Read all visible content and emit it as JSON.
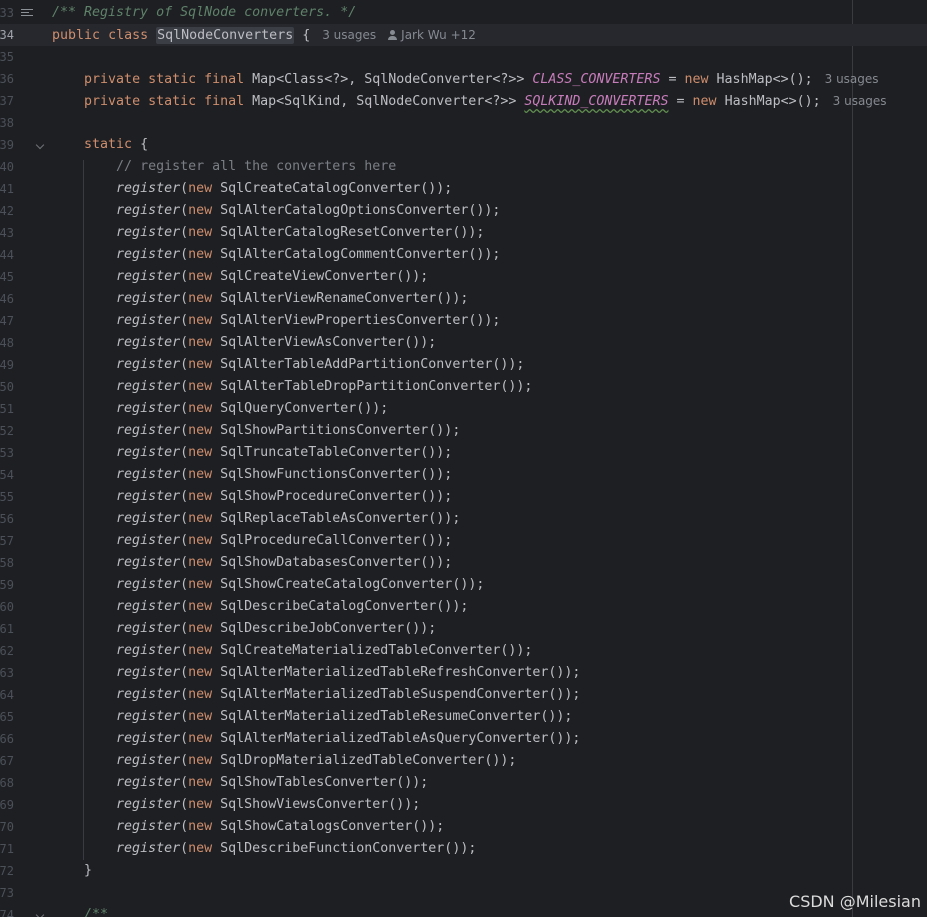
{
  "comment_doc": "/** Registry of SqlNode converters. */",
  "class_decl": {
    "kw_public": "public",
    "kw_class": "class",
    "name": "SqlNodeConverters",
    "brace": "{",
    "usages": "3 usages",
    "authors": "Jark Wu +12"
  },
  "fields": [
    {
      "kw": "private static final",
      "type": "Map<Class<?>, SqlNodeConverter<?>>",
      "name": "CLASS_CONVERTERS",
      "eq": "=",
      "kw_new": "new",
      "init": "HashMap<>();",
      "usages": "3 usages"
    },
    {
      "kw": "private static final",
      "type": "Map<SqlKind, SqlNodeConverter<?>>",
      "name": "SQLKIND_CONVERTERS",
      "eq": "=",
      "kw_new": "new",
      "init": "HashMap<>();",
      "usages": "3 usages"
    }
  ],
  "static_kw": "static",
  "static_brace": "{",
  "inner_comment": "// register all the converters here",
  "register_fn": "register",
  "paren_open": "(",
  "kw_new": "new",
  "converters": [
    "SqlCreateCatalogConverter());",
    "SqlAlterCatalogOptionsConverter());",
    "SqlAlterCatalogResetConverter());",
    "SqlAlterCatalogCommentConverter());",
    "SqlCreateViewConverter());",
    "SqlAlterViewRenameConverter());",
    "SqlAlterViewPropertiesConverter());",
    "SqlAlterViewAsConverter());",
    "SqlAlterTableAddPartitionConverter());",
    "SqlAlterTableDropPartitionConverter());",
    "SqlQueryConverter());",
    "SqlShowPartitionsConverter());",
    "SqlTruncateTableConverter());",
    "SqlShowFunctionsConverter());",
    "SqlShowProcedureConverter());",
    "SqlReplaceTableAsConverter());",
    "SqlProcedureCallConverter());",
    "SqlShowDatabasesConverter());",
    "SqlShowCreateCatalogConverter());",
    "SqlDescribeCatalogConverter());",
    "SqlDescribeJobConverter());",
    "SqlCreateMaterializedTableConverter());",
    "SqlAlterMaterializedTableRefreshConverter());",
    "SqlAlterMaterializedTableSuspendConverter());",
    "SqlAlterMaterializedTableResumeConverter());",
    "SqlAlterMaterializedTableAsQueryConverter());",
    "SqlDropMaterializedTableConverter());",
    "SqlShowTablesConverter());",
    "SqlShowViewsConverter());",
    "SqlShowCatalogsConverter());",
    "SqlDescribeFunctionConverter());"
  ],
  "close_brace": "}",
  "next_doc": "/**",
  "watermark": "CSDN @Milesian",
  "line_numbers": [
    "33",
    "34",
    "35",
    "36",
    "37",
    "38",
    "39",
    "40",
    "41",
    "42",
    "43",
    "44",
    "45",
    "46",
    "47",
    "48",
    "49",
    "50",
    "51",
    "52",
    "53",
    "54",
    "55",
    "56",
    "57",
    "58",
    "59",
    "60",
    "61",
    "62",
    "63",
    "64",
    "65",
    "66",
    "67",
    "68",
    "69",
    "70",
    "71",
    "72",
    "73",
    "74"
  ]
}
